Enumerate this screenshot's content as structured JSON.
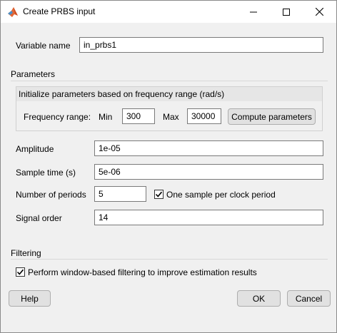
{
  "window": {
    "title": "Create PRBS input"
  },
  "variable_name": {
    "label": "Variable name",
    "value": "in_prbs1"
  },
  "parameters": {
    "section_title": "Parameters",
    "frequency_group": {
      "title": "Initialize parameters based on frequency range (rad/s)",
      "range_label": "Frequency range:",
      "min_label": "Min",
      "min_value": "300",
      "max_label": "Max",
      "max_value": "30000",
      "compute_button": "Compute parameters"
    },
    "amplitude": {
      "label": "Amplitude",
      "value": "1e-05"
    },
    "sample_time": {
      "label": "Sample time (s)",
      "value": "5e-06"
    },
    "periods": {
      "label": "Number of periods",
      "value": "5"
    },
    "one_sample": {
      "label": "One sample per clock period",
      "checked": true
    },
    "signal_order": {
      "label": "Signal order",
      "value": "14"
    }
  },
  "filtering": {
    "section_title": "Filtering",
    "window_filter": {
      "label": "Perform window-based filtering to improve estimation results",
      "checked": true
    }
  },
  "buttons": {
    "help": "Help",
    "ok": "OK",
    "cancel": "Cancel"
  }
}
